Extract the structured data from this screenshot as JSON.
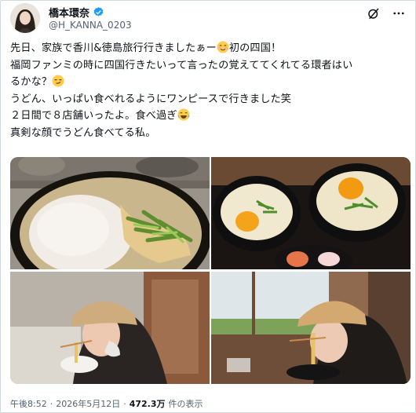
{
  "author": {
    "display_name": "橋本環奈",
    "handle": "@H_KANNA_0203",
    "verified": true
  },
  "header_icons": [
    "grok-icon",
    "more-icon"
  ],
  "tweet": {
    "lines": [
      "先日、家族で香川&徳島旅行行きましたぁー",
      "初の四国！",
      "福岡ファンミの時に四国行きたいって言ったの覚えててくれてる環者はい",
      "るかな？",
      "うどん、いっぱい食べれるようにワンピースで行きました笑",
      "２日間で８店舗いったよ。食べ過ぎ",
      "真剣な顔でうどん食べてる私。"
    ],
    "emojis": [
      "smiling-blush-emoji",
      "smirk-emoji",
      "tears-of-joy-emoji"
    ]
  },
  "media": {
    "photos": [
      "udon-bowl-grated-yam-photo",
      "two-udon-bowls-egg-photo",
      "eating-udon-cap-photo-1",
      "eating-udon-cap-photo-2"
    ]
  },
  "meta": {
    "time": "午後8:52",
    "date": "2026年5月12日",
    "views": "472.3万",
    "views_label": "件の表示"
  },
  "colors": {
    "verified": "#1d9bf0",
    "secondary_text": "#536471",
    "border": "#cfd9de"
  }
}
